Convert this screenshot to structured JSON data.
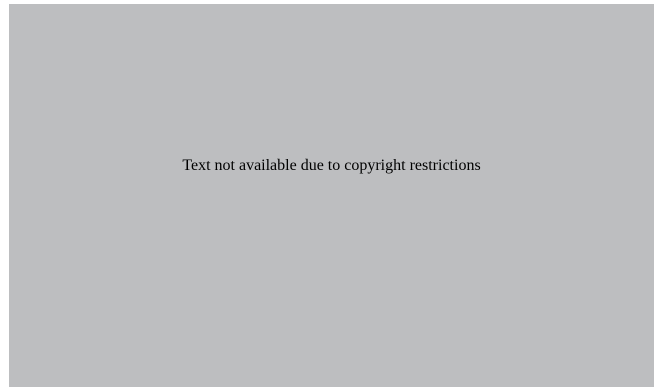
{
  "placeholder": {
    "message": "Text not available due to copyright restrictions",
    "background_color": "#bdbec0",
    "text_color": "#000000"
  }
}
